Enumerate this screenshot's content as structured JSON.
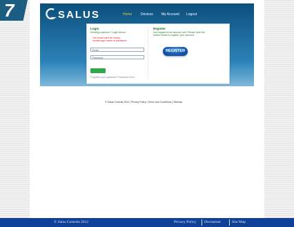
{
  "badge": {
    "number": "7"
  },
  "header": {
    "logo_text": "SALUS",
    "nav": [
      "Home",
      "Devices",
      "My Account",
      "Logout"
    ]
  },
  "login": {
    "title": "Login",
    "subtitle": "Existing customer? Login below.",
    "error_line1": "The email can't be empty",
    "error_line2": "Invalid login name or password.",
    "email_placeholder": "Email",
    "password_placeholder": "Password",
    "forgot_text": "Forgotten your password? Password reset"
  },
  "register": {
    "title": "Register",
    "line1": "Not registered an account yet? Please click the",
    "line2": "button below to register your account.",
    "button_label": "REGISTER"
  },
  "under_links": "© Salus Controls 2012 | Privacy Policy | Terms and Conditions | Sitemap",
  "footer": {
    "copyright": "© Salus Controls 2012",
    "privacy": "Privacy Policy",
    "disclaimer": "Disclaimer",
    "sitemap": "Site Map"
  },
  "colors": {
    "footer_bg": "#0f3f97",
    "header_top": "#0c4f7c",
    "header_bottom": "#7fb8dc",
    "register_button": "#1b62b8",
    "login_button": "#2ea84a",
    "nav_active": "#f4c24a"
  }
}
